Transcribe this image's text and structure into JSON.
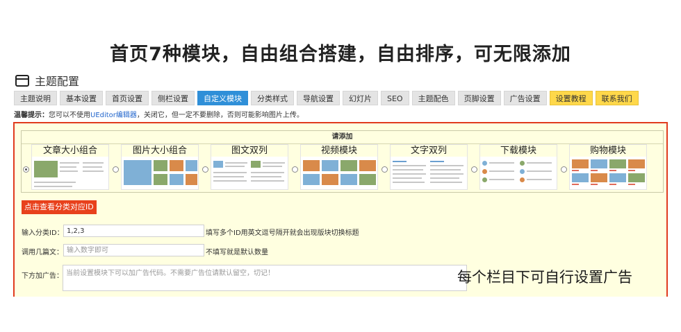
{
  "headline": "首页7种模块，自由组合搭建，自由排序，可无限添加",
  "panel": {
    "title": "主题配置",
    "icon": "window-icon"
  },
  "tabs": [
    {
      "label": "主题说明",
      "style": "normal"
    },
    {
      "label": "基本设置",
      "style": "normal"
    },
    {
      "label": "首页设置",
      "style": "normal"
    },
    {
      "label": "侧栏设置",
      "style": "normal"
    },
    {
      "label": "自定义模块",
      "style": "active"
    },
    {
      "label": "分类样式",
      "style": "normal"
    },
    {
      "label": "导航设置",
      "style": "normal"
    },
    {
      "label": "幻灯片",
      "style": "normal"
    },
    {
      "label": "SEO",
      "style": "normal"
    },
    {
      "label": "主题配色",
      "style": "normal"
    },
    {
      "label": "页脚设置",
      "style": "normal"
    },
    {
      "label": "广告设置",
      "style": "normal"
    },
    {
      "label": "设置教程",
      "style": "yellow"
    },
    {
      "label": "联系我们",
      "style": "yellow"
    }
  ],
  "tip": {
    "prefix": "温馨提示：",
    "text1": "您可以不使用",
    "link": "UEditor编辑器",
    "text2": "，关闭它，但一定不要删除，否则可能影响图片上传。"
  },
  "modules": {
    "header": "请添加",
    "items": [
      {
        "name": "文章大小组合",
        "checked": true
      },
      {
        "name": "图片大小组合",
        "checked": false
      },
      {
        "name": "图文双列",
        "checked": false
      },
      {
        "name": "视频模块",
        "checked": false
      },
      {
        "name": "文字双列",
        "checked": false
      },
      {
        "name": "下载模块",
        "checked": false
      },
      {
        "name": "购物模块",
        "checked": false
      }
    ]
  },
  "category_button": "点击查看分类对应ID",
  "form": {
    "category_label": "输入分类ID：",
    "category_value": "1,2,3",
    "category_hint": "填写多个ID用英文逗号隔开就会出现版块切换标题",
    "count_label": "调用几篇文：",
    "count_placeholder": "输入数字即可",
    "count_hint": "不填写就是默认数量",
    "ad_label": "下方加广告：",
    "ad_placeholder": "当前设置模块下可以加广告代码。不需要广告位请默认留空，切记！"
  },
  "overlay_caption": "每个栏目下可自行设置广告",
  "colors": {
    "accent": "#2f8fd8",
    "border_red": "#e03b1e",
    "panel_bg": "#ffffe0",
    "button_red": "#e8411c"
  }
}
